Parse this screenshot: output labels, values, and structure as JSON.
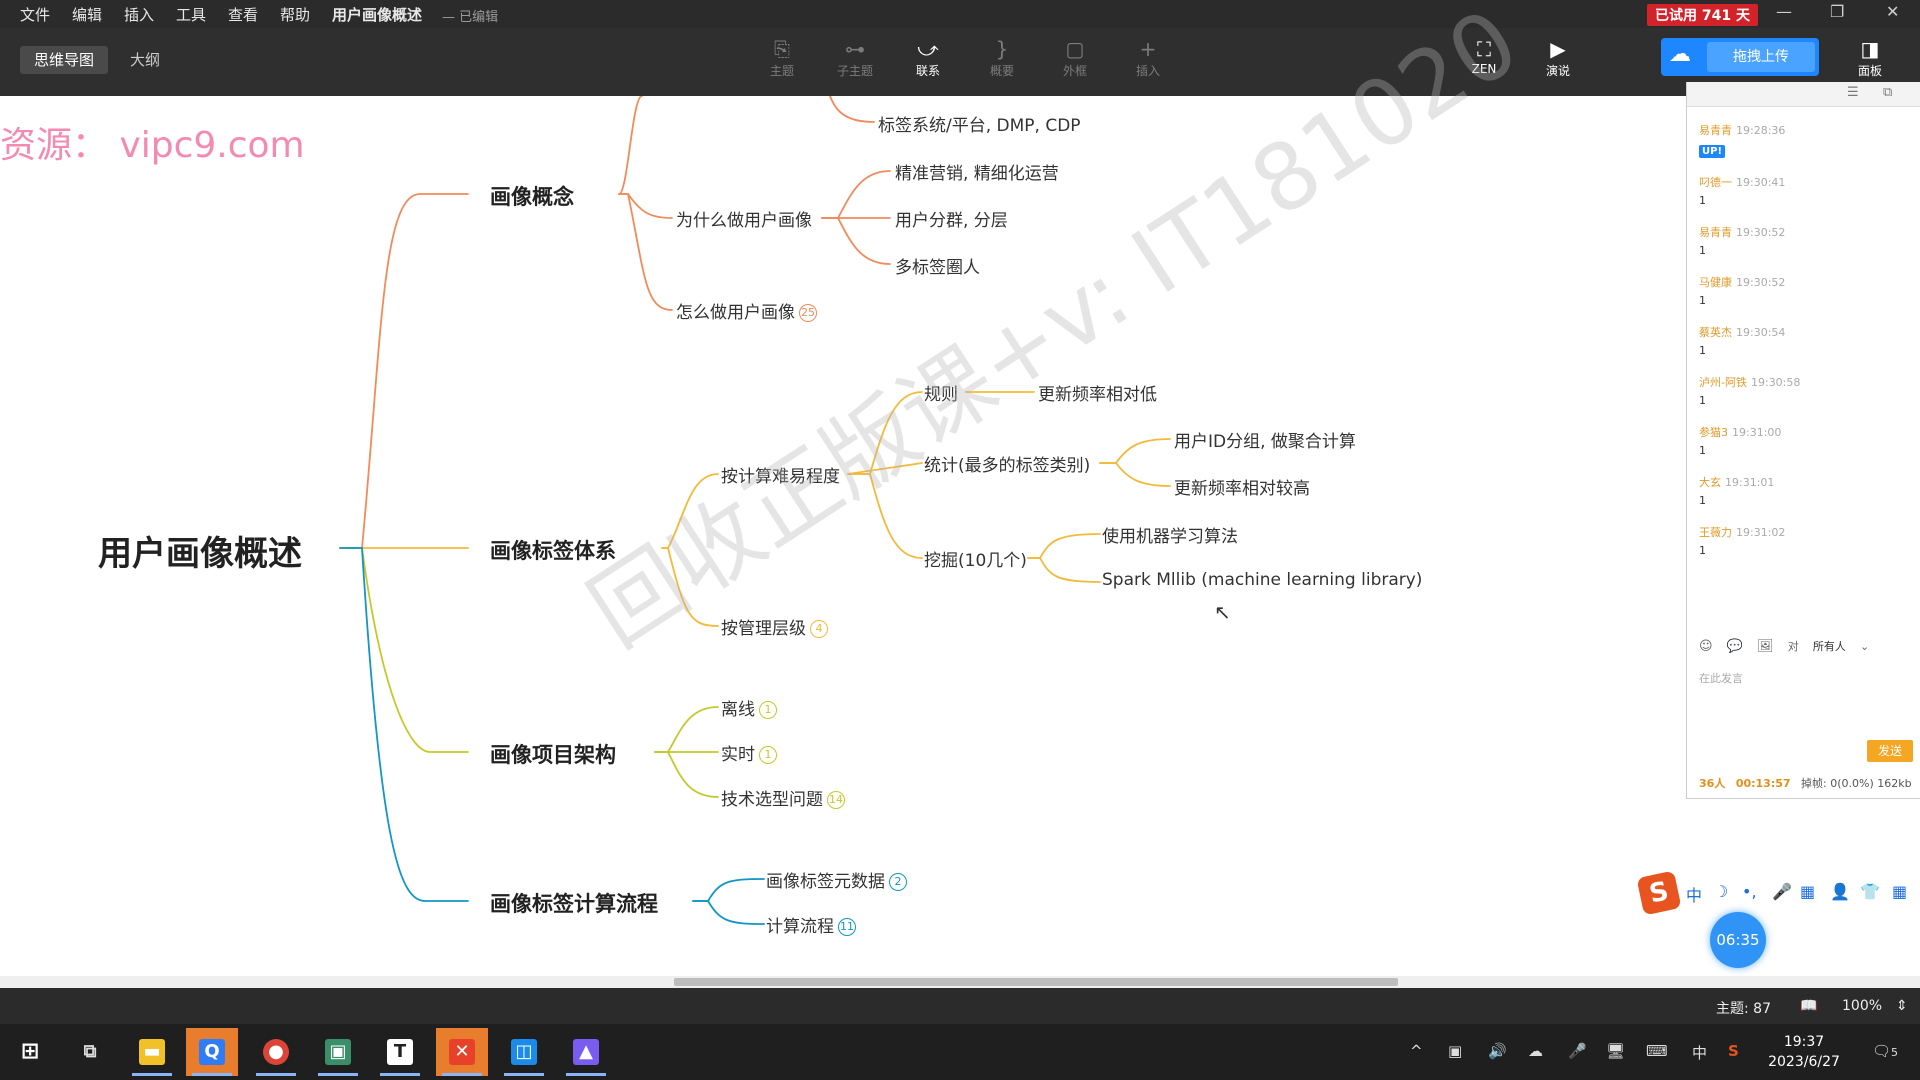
{
  "app": {
    "menu": [
      "文件",
      "编辑",
      "插入",
      "工具",
      "查看",
      "帮助"
    ],
    "doc_title": "用户画像概述",
    "doc_status": "— 已编辑",
    "trial": "已试用 741 天",
    "win_minimize": "—",
    "win_restore": "❐",
    "win_close": "✕"
  },
  "toolbar": {
    "view_tabs": [
      "思维导图",
      "大纲"
    ],
    "tools": [
      {
        "label": "主题",
        "icon": "⎘"
      },
      {
        "label": "子主题",
        "icon": "⊶"
      },
      {
        "label": "联系",
        "icon": "⤻"
      },
      {
        "label": "概要",
        "icon": "}"
      },
      {
        "label": "外框",
        "icon": "▢"
      },
      {
        "label": "插入",
        "icon": "+"
      }
    ],
    "zen": {
      "label": "ZEN",
      "icon": "⛶"
    },
    "present": {
      "label": "演说",
      "icon": "▶"
    },
    "upload_label": "拖拽上传",
    "panel_label": "面板"
  },
  "mindmap": {
    "root": "用户画像概述",
    "mains": [
      "画像概念",
      "画像标签体系",
      "画像项目架构",
      "画像标签计算流程"
    ],
    "concept": {
      "partial_child": "标签系统/平台, DMP, CDP",
      "why": "为什么做用户画像",
      "why_children": [
        "精准营销, 精细化运营",
        "用户分群, 分层",
        "多标签圈人"
      ],
      "how": "怎么做用户画像",
      "how_badge": "25"
    },
    "tag_system": {
      "by_difficulty": "按计算难易程度",
      "rule": "规则",
      "rule_child": "更新频率相对低",
      "stat": "统计(最多的标签类别)",
      "stat_children": [
        "用户ID分组, 做聚合计算",
        "更新频率相对较高"
      ],
      "mining": "挖掘(10几个)",
      "mining_children": [
        "使用机器学习算法",
        "Spark Mllib (machine learning library)"
      ],
      "by_level": "按管理层级",
      "by_level_badge": "4"
    },
    "architecture": {
      "items": [
        {
          "label": "离线",
          "badge": "1"
        },
        {
          "label": "实时",
          "badge": "1"
        },
        {
          "label": "技术选型问题",
          "badge": "14"
        }
      ]
    },
    "calc_flow": {
      "items": [
        {
          "label": "画像标签元数据",
          "badge": "2"
        },
        {
          "label": "计算流程",
          "badge": "11"
        }
      ]
    },
    "colors": {
      "concept": "#f28a5b",
      "tag_system": "#f4b93b",
      "architecture": "#c4c92b",
      "calc_flow": "#1296c5"
    }
  },
  "watermarks": {
    "source": "资源：  vipc9.com",
    "diagonal": "回收正版课+v: IT181020"
  },
  "chat": {
    "header_icons": [
      "☰",
      "⧉"
    ],
    "messages": [
      {
        "user": "易青青",
        "time": "19:28:36",
        "content": "",
        "up": "UP!"
      },
      {
        "user": "叼德一",
        "time": "19:30:41",
        "content": "1"
      },
      {
        "user": "易青青",
        "time": "19:30:52",
        "content": "1"
      },
      {
        "user": "马健康",
        "time": "19:30:52",
        "content": "1"
      },
      {
        "user": "蔡英杰",
        "time": "19:30:54",
        "content": "1"
      },
      {
        "user": "泸州-阿铁",
        "time": "19:30:58",
        "content": "1"
      },
      {
        "user": "参猫3",
        "time": "19:31:00",
        "content": "1"
      },
      {
        "user": "大玄",
        "time": "19:31:01",
        "content": "1"
      },
      {
        "user": "王薇力",
        "time": "19:31:02",
        "content": "1"
      }
    ],
    "to_label": "对",
    "audience": "所有人",
    "input_placeholder": "在此发言",
    "send": "发送",
    "footer_count": "36人",
    "footer_time": "00:13:57",
    "footer_stats": "掉帧: 0(0.0%) 162kb"
  },
  "ime": {
    "logo": "S",
    "keys": [
      "中",
      "☽",
      "•,",
      "🎤",
      "▦",
      "👤",
      "👕",
      "▦"
    ]
  },
  "timer": "06:35",
  "status": {
    "topics": "主题: 87",
    "zoom": "100%"
  },
  "taskbar": {
    "apps": [
      {
        "name": "start",
        "glyph": "⊞",
        "color": "#1f1f1f"
      },
      {
        "name": "task-view",
        "glyph": "⧉",
        "color": "#1f1f1f"
      },
      {
        "name": "file-explorer",
        "glyph": "▬",
        "color": "#f2c029"
      },
      {
        "name": "tencent-meeting",
        "glyph": "Q",
        "color": "#2f7df6"
      },
      {
        "name": "chrome",
        "glyph": "●",
        "color": "#db4437"
      },
      {
        "name": "video-app",
        "glyph": "▣",
        "color": "#3a8f6a"
      },
      {
        "name": "typora",
        "glyph": "T",
        "color": "#ffffff"
      },
      {
        "name": "xmind",
        "glyph": "✕",
        "color": "#e8412a"
      },
      {
        "name": "remote-app",
        "glyph": "◫",
        "color": "#1a8be8"
      },
      {
        "name": "photos",
        "glyph": "▲",
        "color": "#7a5cf0"
      }
    ],
    "tray_icons": [
      "^",
      "▣",
      "🔊",
      "☁",
      "🎤",
      "🖥",
      "⌨",
      "中",
      "S"
    ],
    "time": "19:37",
    "date": "2023/6/27",
    "notif": "5"
  }
}
